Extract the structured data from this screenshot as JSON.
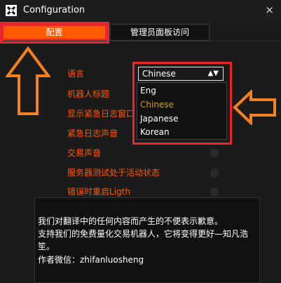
{
  "window": {
    "title": "Configuration",
    "close_icon": "×"
  },
  "tabs": [
    {
      "label": "配置",
      "active": true
    },
    {
      "label": "管理员面板访问",
      "active": false
    }
  ],
  "settings": [
    {
      "label": "语言"
    },
    {
      "label": "机器人标题"
    },
    {
      "label": "显示紧急日志窗口"
    },
    {
      "label": "紧急日志声音"
    },
    {
      "label": "交易声音"
    },
    {
      "label": "服务器测试处于活动状态"
    },
    {
      "label": "错误时重启Ligth"
    }
  ],
  "language_select": {
    "value": "Chinese",
    "options": [
      "Eng",
      "Chinese",
      "Japanese",
      "Korean"
    ]
  },
  "info": {
    "lines": [
      "我们对翻译中的任何内容而产生的不便表示歉意。",
      "支持我们的免费量化交易机器人，它将变得更好—知凡浩",
      "笙。",
      "作者微信：zhifanluosheng"
    ]
  },
  "colors": {
    "accent": "#ff5a00",
    "annotation": "#e8262b",
    "arrow": "#f58220"
  }
}
